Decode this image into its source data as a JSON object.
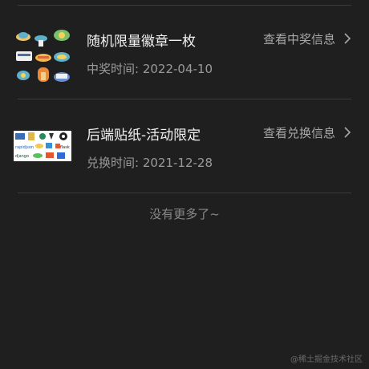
{
  "list": {
    "items": [
      {
        "title": "随机限量徽章一枚",
        "time_text": "中奖时间: 2022-04-10",
        "action_label": "查看中奖信息",
        "thumb_icon": "badge-stickers-icon"
      },
      {
        "title": "后端贴纸-活动限定",
        "time_text": "兑换时间: 2021-12-28",
        "action_label": "查看兑换信息",
        "thumb_icon": "backend-stickers-icon",
        "thumb_labels": [
          "rapidjson",
          "django",
          "flask"
        ]
      }
    ],
    "end_text": "没有更多了~"
  },
  "watermark": "@稀土掘金技术社区",
  "colors": {
    "background": "#1f1f1f",
    "divider": "#3b3b3b",
    "title": "#f2f2f2",
    "secondary": "#9a9a9a"
  }
}
